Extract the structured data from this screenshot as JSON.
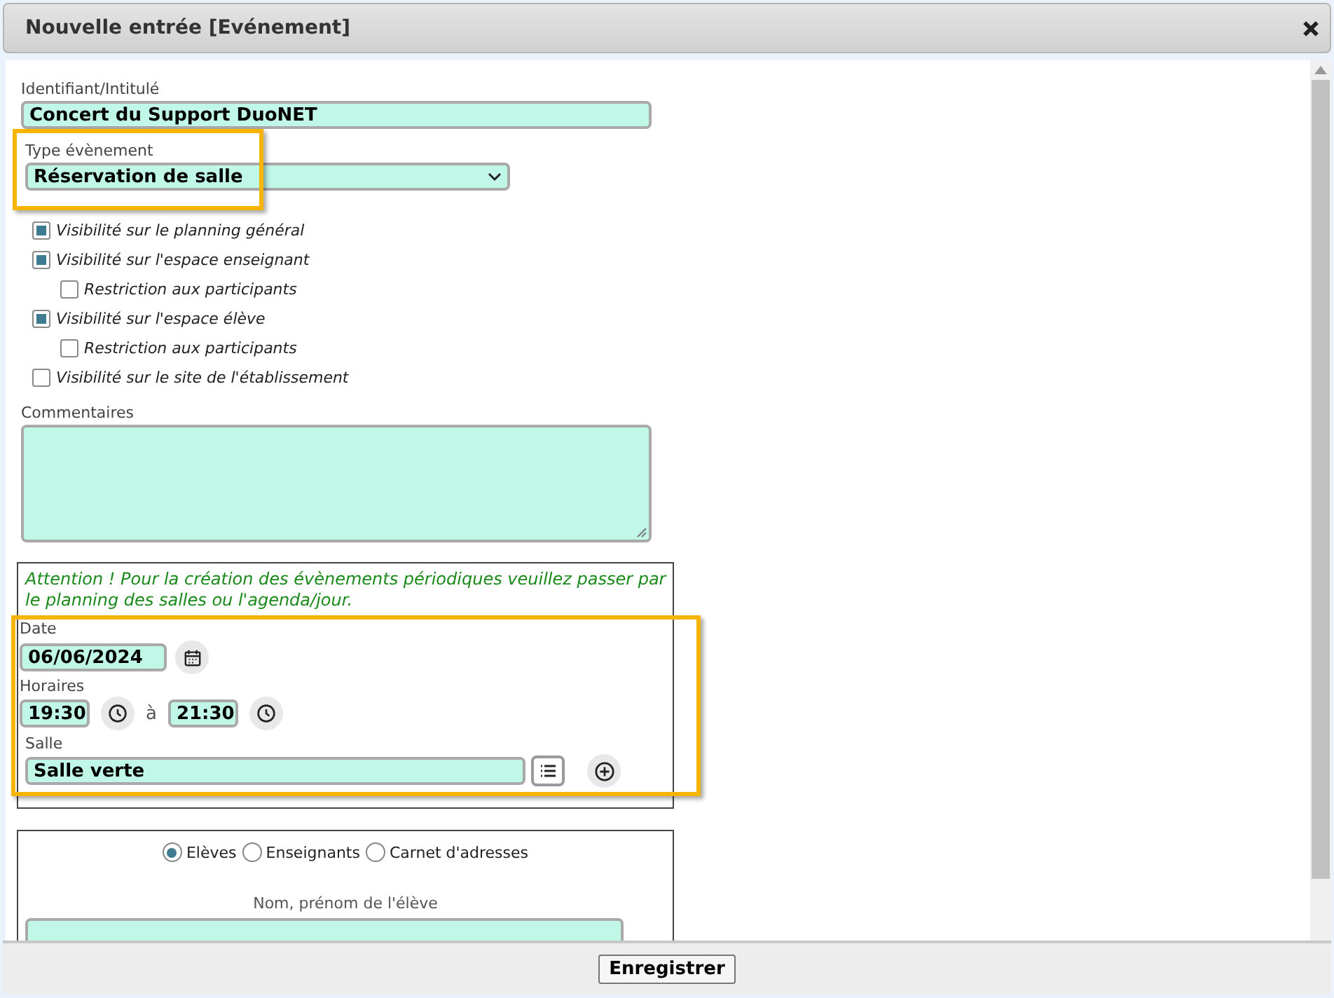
{
  "dialog": {
    "title": "Nouvelle entrée [Evénement]"
  },
  "identifier": {
    "label": "Identifiant/Intitulé",
    "value": "Concert du Support DuoNET"
  },
  "event_type": {
    "label": "Type évènement",
    "value": "Réservation de salle"
  },
  "visibility": [
    {
      "label": "Visibilité sur le planning général",
      "checked": true
    },
    {
      "label": "Visibilité sur l'espace enseignant",
      "checked": true,
      "children": [
        {
          "label": "Restriction aux participants",
          "checked": false
        }
      ]
    },
    {
      "label": "Visibilité sur l'espace élève",
      "checked": true,
      "children": [
        {
          "label": "Restriction aux participants",
          "checked": false
        }
      ]
    },
    {
      "label": "Visibilité sur le site de l'établissement",
      "checked": false
    }
  ],
  "comments": {
    "label": "Commentaires"
  },
  "schedule": {
    "warning": "Attention ! Pour la création des évènements périodiques veuillez passer par le planning des salles ou l'agenda/jour.",
    "date_label": "Date",
    "date": "06/06/2024",
    "hours_label": "Horaires",
    "start": "19:30",
    "between": "à",
    "end": "21:30",
    "room_label": "Salle",
    "room": "Salle verte"
  },
  "participants": {
    "options": [
      {
        "label": "Elèves",
        "selected": true
      },
      {
        "label": "Enseignants",
        "selected": false
      },
      {
        "label": "Carnet d'adresses",
        "selected": false
      }
    ],
    "name_label": "Nom, prénom de l'élève"
  },
  "footer": {
    "save": "Enregistrer"
  }
}
